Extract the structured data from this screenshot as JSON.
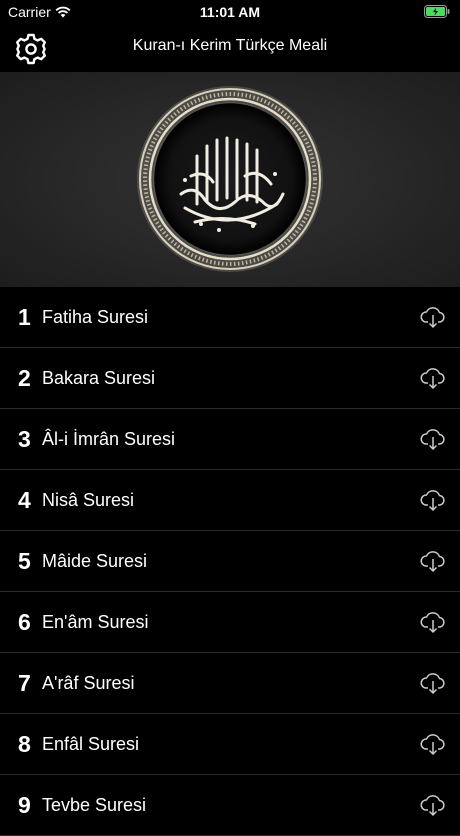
{
  "status_bar": {
    "carrier": "Carrier",
    "time": "11:01 AM"
  },
  "nav": {
    "title": "Kuran-ı Kerim Türkçe Meali"
  },
  "surahs": [
    {
      "number": "1",
      "name": "Fatiha Suresi"
    },
    {
      "number": "2",
      "name": "Bakara Suresi"
    },
    {
      "number": "3",
      "name": "Âl-i İmrân Suresi"
    },
    {
      "number": "4",
      "name": "Nisâ Suresi"
    },
    {
      "number": "5",
      "name": "Mâide Suresi"
    },
    {
      "number": "6",
      "name": "En'âm Suresi"
    },
    {
      "number": "7",
      "name": "A'râf Suresi"
    },
    {
      "number": "8",
      "name": "Enfâl Suresi"
    },
    {
      "number": "9",
      "name": "Tevbe Suresi"
    }
  ],
  "icons": {
    "settings": "gear-icon",
    "download": "cloud-download-icon",
    "emblem": "bismillah-calligraphy-emblem"
  },
  "colors": {
    "background": "#000000",
    "battery": "#4cd964"
  }
}
